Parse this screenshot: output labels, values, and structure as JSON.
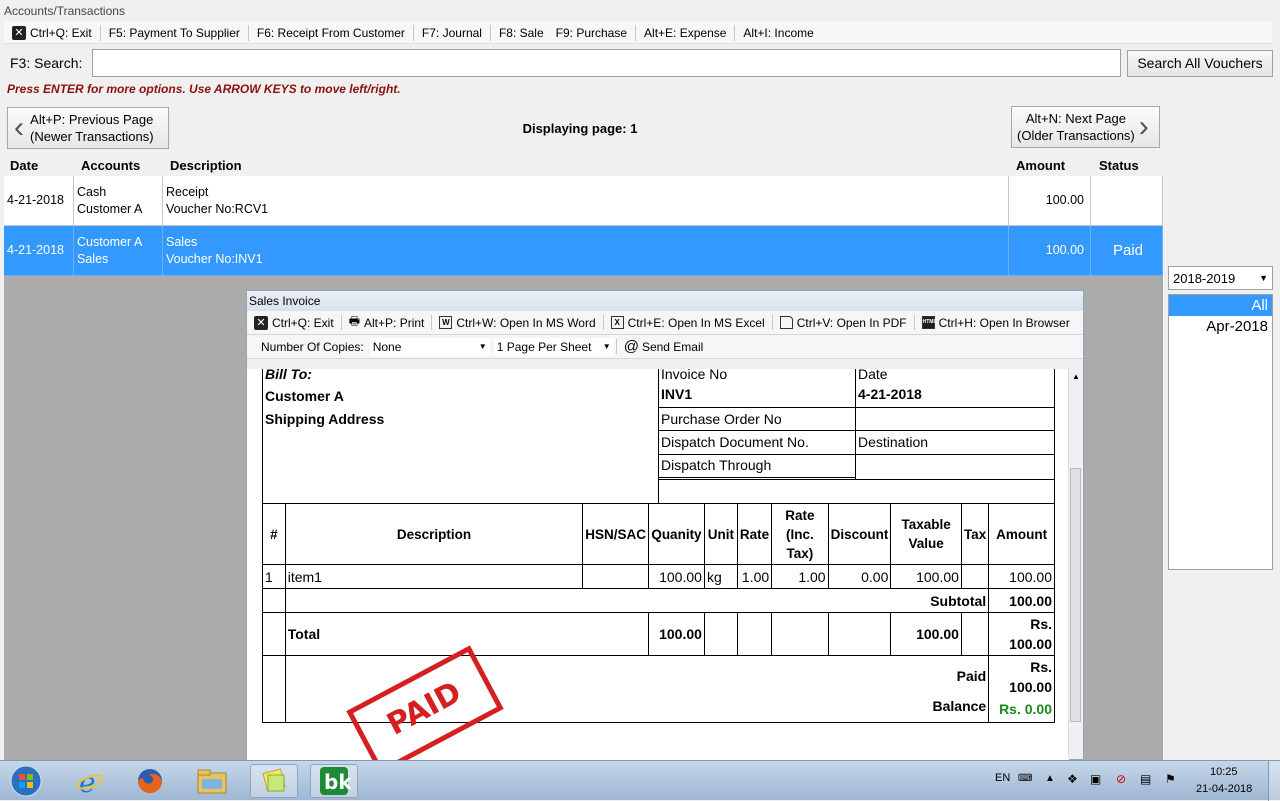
{
  "window": {
    "title": "Accounts/Transactions"
  },
  "toolbar": {
    "items": [
      {
        "label": "Ctrl+Q: Exit"
      },
      {
        "label": "F5: Payment To Supplier"
      },
      {
        "label": "F6: Receipt From Customer"
      },
      {
        "label": "F7: Journal"
      },
      {
        "label": "F8: Sale"
      },
      {
        "label": "F9: Purchase"
      },
      {
        "label": "Alt+E: Expense"
      },
      {
        "label": "Alt+I: Income"
      }
    ]
  },
  "search": {
    "label": "F3: Search:",
    "value": "",
    "button": "Search All Vouchers"
  },
  "hint": "Press ENTER for more options. Use ARROW KEYS to move left/right.",
  "nav": {
    "prev_line1": "Alt+P: Previous Page",
    "prev_line2": "(Newer Transactions)",
    "next_line1": "Alt+N: Next Page",
    "next_line2": "(Older Transactions)",
    "page_label": "Displaying page: 1"
  },
  "grid": {
    "headers": {
      "date": "Date",
      "accounts": "Accounts",
      "description": "Description",
      "amount": "Amount",
      "status": "Status"
    },
    "rows": [
      {
        "date": "4-21-2018",
        "acc1": "Cash",
        "acc2": "Customer A",
        "desc1": "Receipt",
        "desc2": "Voucher No:RCV1",
        "amount": "100.00",
        "status": ""
      },
      {
        "date": "4-21-2018",
        "acc1": "Customer A",
        "acc2": "Sales",
        "desc1": "Sales",
        "desc2": "Voucher No:INV1",
        "amount": "100.00",
        "status": "Paid"
      }
    ]
  },
  "right_panel": {
    "year": "2018-2019",
    "periods": [
      "All",
      "Apr-2018"
    ]
  },
  "invoice_window": {
    "title": "Sales Invoice",
    "toolbar": [
      {
        "label": "Ctrl+Q: Exit"
      },
      {
        "label": "Alt+P: Print"
      },
      {
        "label": "Ctrl+W: Open In MS Word"
      },
      {
        "label": "Ctrl+E: Open In MS Excel"
      },
      {
        "label": "Ctrl+V: Open In PDF"
      },
      {
        "label": "Ctrl+H: Open In Browser"
      }
    ],
    "copies_label": "Number Of Copies:",
    "copies_value": "None",
    "sheet_value": "1 Page Per Sheet",
    "send_email": "Send Email",
    "doc": {
      "bill_to": "Bill To:",
      "customer": "Customer A",
      "shipping": "Shipping Address",
      "invoice_no_label": "Invoice No",
      "invoice_no": "INV1",
      "date_label": "Date",
      "date": "4-21-2018",
      "po_label": "Purchase Order No",
      "dispatch_doc_label": "Dispatch Document No.",
      "destination_label": "Destination",
      "dispatch_through_label": "Dispatch Through",
      "headers": [
        "#",
        "Description",
        "HSN/SAC",
        "Quanity",
        "Unit",
        "Rate",
        "Rate (Inc. Tax)",
        "Discount",
        "Taxable Value",
        "Tax",
        "Amount"
      ],
      "item": {
        "no": "1",
        "desc": "item1",
        "hsn": "",
        "qty": "100.00",
        "unit": "kg",
        "rate": "1.00",
        "rate_inc": "1.00",
        "discount": "0.00",
        "taxable": "100.00",
        "tax": "",
        "amount": "100.00"
      },
      "subtotal_label": "Subtotal",
      "subtotal": "100.00",
      "total_label": "Total",
      "total_qty": "100.00",
      "total_taxable": "100.00",
      "total_rs": "Rs.",
      "total_amount": "100.00",
      "paid_label": "Paid",
      "paid_rs": "Rs.",
      "paid_amount": "100.00",
      "balance_label": "Balance",
      "balance": "Rs. 0.00",
      "stamp": "PAID"
    }
  },
  "taskbar": {
    "lang": "EN",
    "time": "10:25",
    "date": "21-04-2018"
  },
  "colors": {
    "selection": "#3399ff",
    "hint": "#8b1010",
    "stamp": "#d42020",
    "balance": "#1a8a1a"
  }
}
